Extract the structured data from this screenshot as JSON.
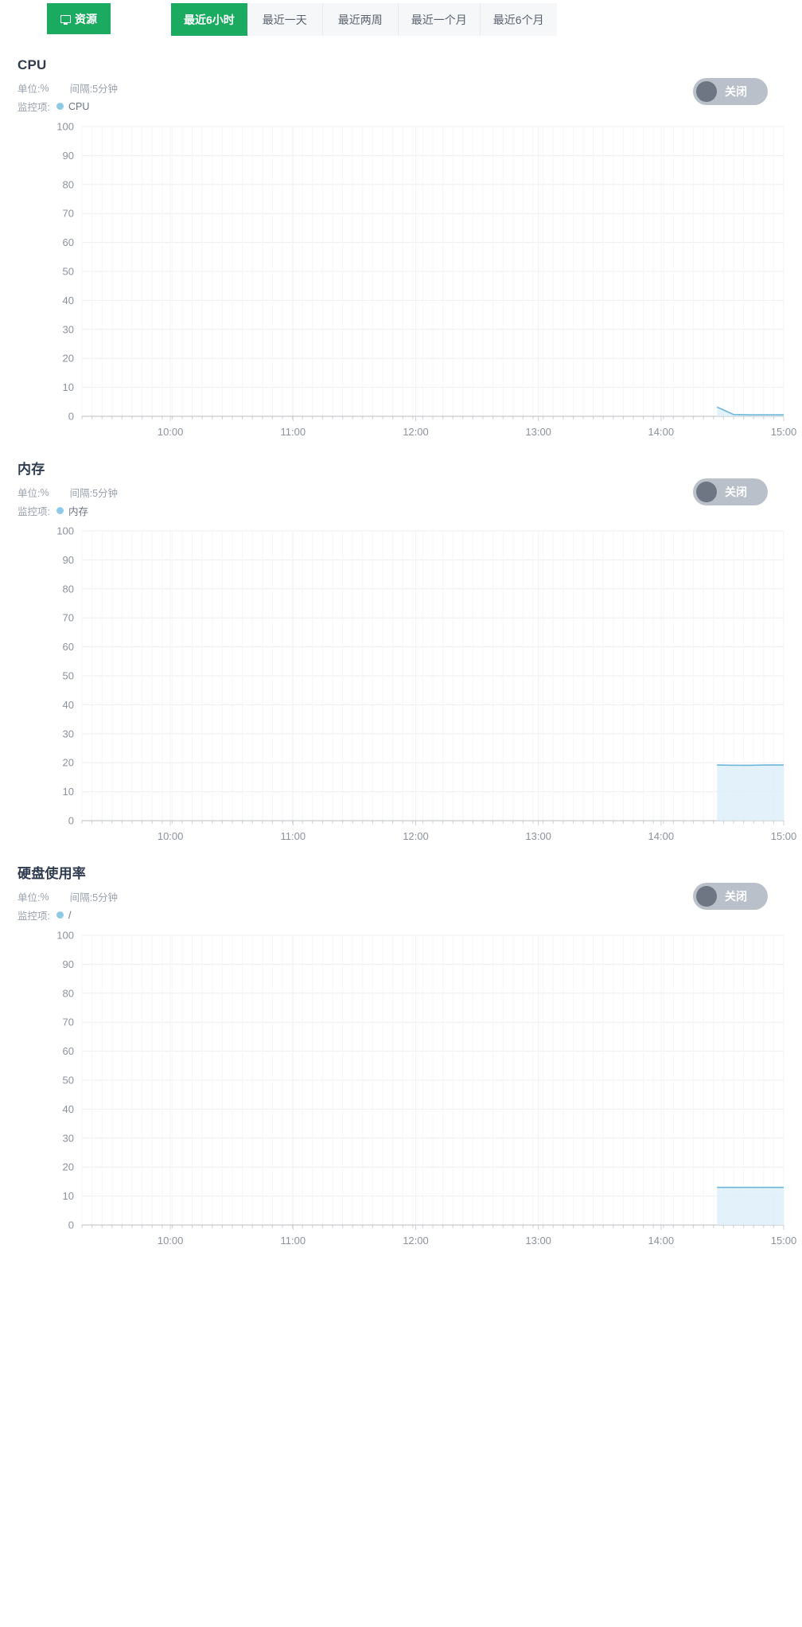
{
  "header": {
    "resource_button": {
      "label": "资源",
      "icon": "monitor-icon",
      "color": "#1aab61"
    },
    "time_ranges": [
      {
        "label": "最近6小时",
        "active": true
      },
      {
        "label": "最近一天",
        "active": false
      },
      {
        "label": "最近两周",
        "active": false
      },
      {
        "label": "最近一个月",
        "active": false
      },
      {
        "label": "最近6个月",
        "active": false
      }
    ]
  },
  "labels": {
    "unit_prefix": "单位: ",
    "interval_prefix": "间隔: ",
    "monitor_prefix": "监控项:"
  },
  "panels": [
    {
      "title": "CPU",
      "unit": "%",
      "interval": "5分钟",
      "monitor_label": "监控项:",
      "series_name": "CPU",
      "toggle": {
        "label": "关闭",
        "state": "off"
      }
    },
    {
      "title": "内存",
      "unit": "%",
      "interval": "5分钟",
      "monitor_label": "监控项:",
      "series_name": "内存",
      "toggle": {
        "label": "关闭",
        "state": "off"
      }
    },
    {
      "title": "硬盘使用率",
      "unit": "%",
      "interval": "5分钟",
      "monitor_label": "监控项:",
      "series_name": "/",
      "toggle": {
        "label": "关闭",
        "state": "off"
      }
    }
  ],
  "chart_data": [
    {
      "type": "area",
      "title": "CPU",
      "xlabel": "",
      "ylabel": "%",
      "ylim": [
        0,
        100
      ],
      "yticks": [
        0,
        10,
        20,
        30,
        40,
        50,
        60,
        70,
        80,
        90,
        100
      ],
      "xticks": [
        "10:00",
        "11:00",
        "12:00",
        "13:00",
        "14:00",
        "15:00"
      ],
      "grid": true,
      "legend": [
        "CPU"
      ],
      "series": [
        {
          "name": "CPU",
          "color": "#6cb6da",
          "x": [
            "14:40",
            "14:45",
            "14:50",
            "14:55",
            "15:00"
          ],
          "values": [
            3.2,
            0.6,
            0.5,
            0.5,
            0.5
          ]
        }
      ]
    },
    {
      "type": "area",
      "title": "内存",
      "xlabel": "",
      "ylabel": "%",
      "ylim": [
        0,
        100
      ],
      "yticks": [
        0,
        10,
        20,
        30,
        40,
        50,
        60,
        70,
        80,
        90,
        100
      ],
      "xticks": [
        "10:00",
        "11:00",
        "12:00",
        "13:00",
        "14:00",
        "15:00"
      ],
      "grid": true,
      "legend": [
        "内存"
      ],
      "series": [
        {
          "name": "内存",
          "color": "#6cb6da",
          "x": [
            "14:40",
            "14:45",
            "14:50",
            "14:55",
            "15:00"
          ],
          "values": [
            19.2,
            19.1,
            19.1,
            19.2,
            19.2
          ]
        }
      ]
    },
    {
      "type": "area",
      "title": "硬盘使用率",
      "xlabel": "",
      "ylabel": "%",
      "ylim": [
        0,
        100
      ],
      "yticks": [
        0,
        10,
        20,
        30,
        40,
        50,
        60,
        70,
        80,
        90,
        100
      ],
      "xticks": [
        "10:00",
        "11:00",
        "12:00",
        "13:00",
        "14:00",
        "15:00"
      ],
      "grid": true,
      "legend": [
        "/"
      ],
      "series": [
        {
          "name": "/",
          "color": "#6cb6da",
          "x": [
            "14:40",
            "14:45",
            "14:50",
            "14:55",
            "15:00"
          ],
          "values": [
            13.0,
            13.0,
            13.0,
            13.0,
            13.0
          ]
        }
      ]
    }
  ]
}
